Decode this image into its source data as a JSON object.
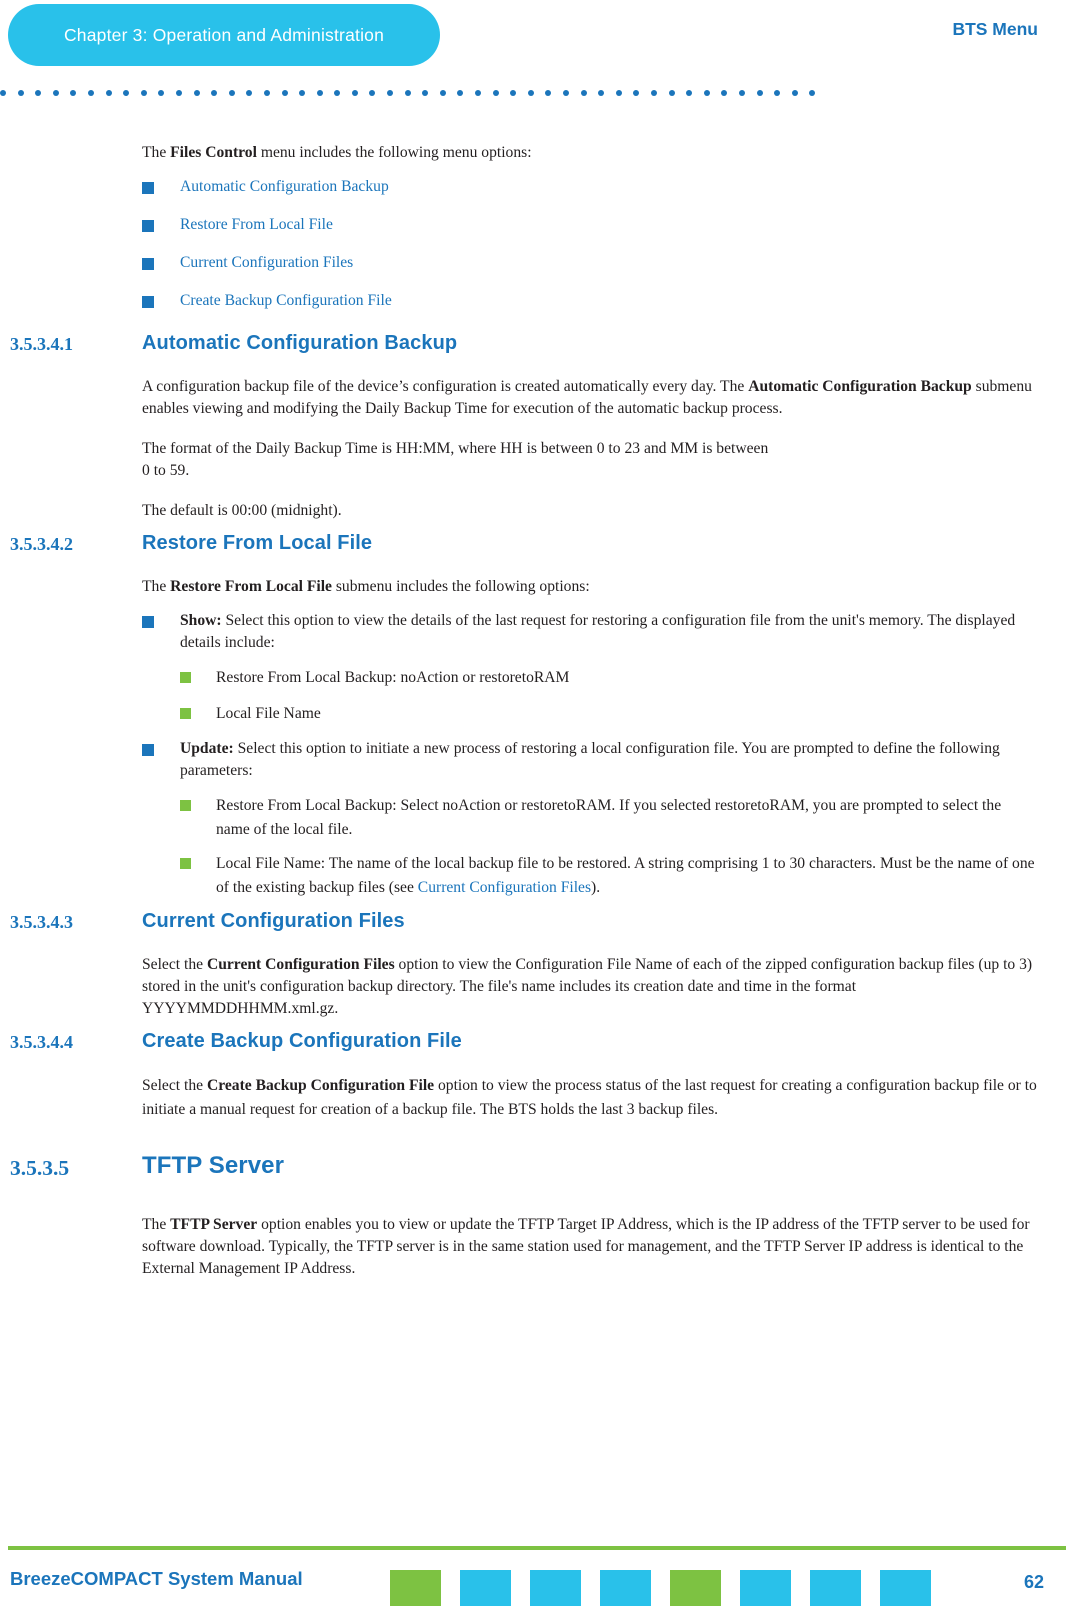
{
  "header": {
    "chapter_label": "Chapter 3: Operation and Administration",
    "menu_label": "BTS Menu",
    "accent_cyan": "#29c1ea",
    "accent_blue": "#1b75bb",
    "accent_green": "#7dc242",
    "dot_count": 47
  },
  "intro": {
    "lead_plain_1": "The ",
    "lead_bold": "Files Control",
    "lead_plain_2": " menu includes the following menu options:",
    "options": [
      "Automatic Configuration Backup",
      "Restore From Local File",
      "Current Configuration Files",
      "Create Backup Configuration File"
    ]
  },
  "sections": {
    "s1": {
      "number": "3.5.3.4.1",
      "title": "Automatic Configuration Backup",
      "p1_a": "A configuration backup file of the device’s configuration is created automatically every day. The ",
      "p1_b": "Automatic Configuration Backup",
      "p1_c": " submenu enables viewing and modifying the Daily Backup Time for execution of the automatic backup process.",
      "p2_line1": "The format of the Daily Backup Time is HH:MM, where HH is between 0 to 23 and MM is between",
      "p2_line2": "0 to 59.",
      "p3": "The default is 00:00 (midnight)."
    },
    "s2": {
      "number": "3.5.3.4.2",
      "title": "Restore From Local File",
      "p1_a": "The ",
      "p1_b": "Restore From Local File",
      "p1_c": " submenu includes the following options:",
      "show_bold": "Show:",
      "show_text": " Select this option to view the details of the last request for restoring a configuration file from the unit's memory. The displayed details include:",
      "show_sub": [
        "Restore From Local Backup: noAction or restoretoRAM",
        "Local File Name"
      ],
      "update_bold": "Update:",
      "update_text": " Select this option to initiate a new process of restoring a local configuration file. You are prompted to define the following parameters:",
      "update_sub_1": "Restore From Local Backup: Select noAction or restoretoRAM. If you selected restoretoRAM, you are prompted to select the name of the local file.",
      "update_sub_2_a": "Local File Name: The name of the local backup file to be restored. A string comprising 1 to 30 characters. Must be the name of one of the existing backup files (see ",
      "update_sub_2_link": "Current Configuration Files",
      "update_sub_2_b": ")."
    },
    "s3": {
      "number": "3.5.3.4.3",
      "title": "Current Configuration Files",
      "p1_a": "Select the ",
      "p1_b": "Current Configuration Files",
      "p1_c": " option to view the Configuration File Name of each of the zipped configuration backup files (up to 3) stored in the unit's configuration backup directory. The file's name includes its creation date and time in the format YYYYMMDDHHMM.xml.gz."
    },
    "s4": {
      "number": "3.5.3.4.4",
      "title": "Create Backup Configuration File",
      "p1_a": "Select the ",
      "p1_b": "Create Backup Configuration File",
      "p1_c": " option to view the process status of the last request for creating a configuration backup file or to initiate a manual request for creation of a backup file. The BTS holds the last 3 backup files."
    },
    "s5": {
      "number": "3.5.3.5",
      "title": "TFTP Server",
      "p1_a": "The ",
      "p1_b": "TFTP Server",
      "p1_c": " option enables you to view or update the TFTP Target IP Address, which is the IP address of the TFTP server to be used for software download. Typically, the TFTP server is in the same station used for management, and the TFTP Server IP address is identical to the External Management IP Address."
    }
  },
  "footer": {
    "manual_title": "BreezeCOMPACT System Manual",
    "page_number": "62",
    "square_colors": [
      "#7dc242",
      "#29c1ea",
      "#29c1ea",
      "#29c1ea",
      "#7dc242",
      "#29c1ea",
      "#29c1ea",
      "#29c1ea"
    ]
  }
}
